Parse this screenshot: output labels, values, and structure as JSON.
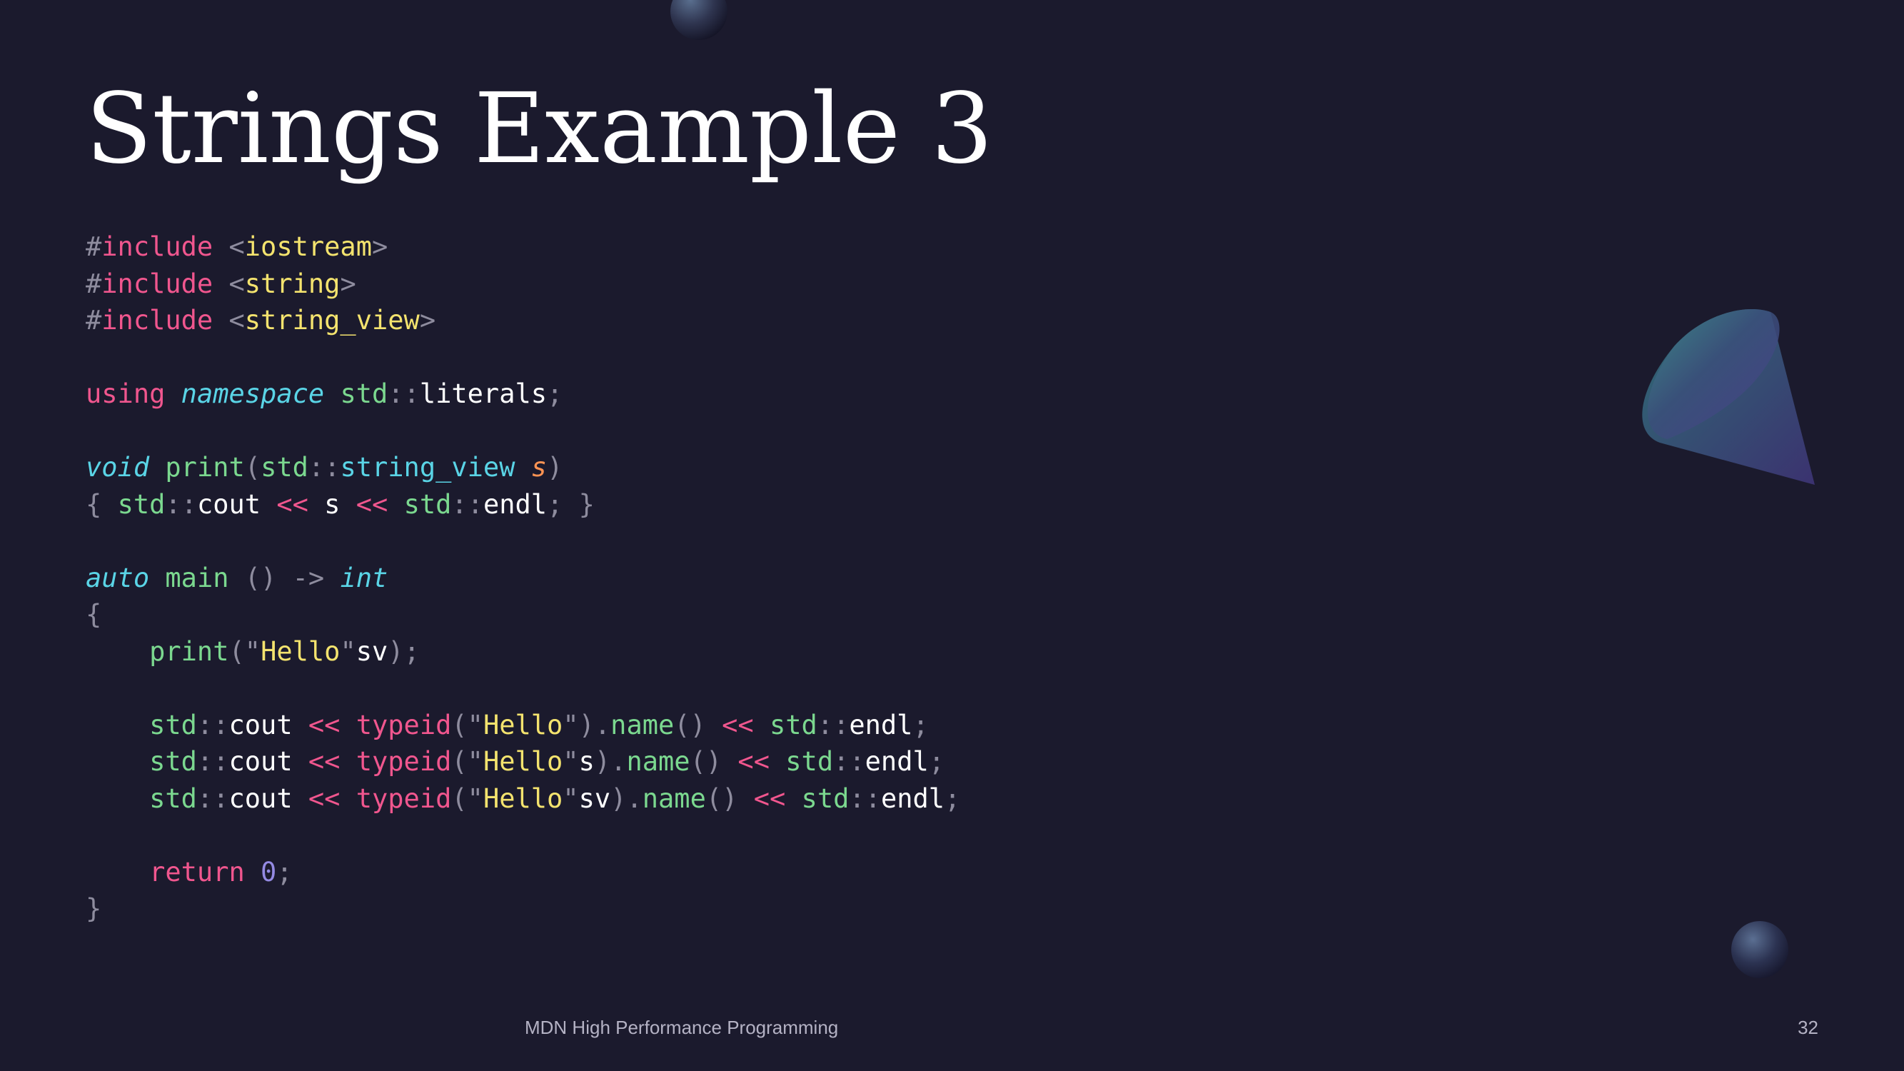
{
  "slide": {
    "title": "Strings Example 3",
    "footer": "MDN High Performance Programming",
    "page_number": "32"
  },
  "code": {
    "language": "cpp",
    "lines": [
      [
        [
          "punct",
          "#"
        ],
        [
          "kw",
          "include"
        ],
        [
          "plain",
          " "
        ],
        [
          "punct",
          "<"
        ],
        [
          "str",
          "iostream"
        ],
        [
          "punct",
          ">"
        ]
      ],
      [
        [
          "punct",
          "#"
        ],
        [
          "kw",
          "include"
        ],
        [
          "plain",
          " "
        ],
        [
          "punct",
          "<"
        ],
        [
          "str",
          "string"
        ],
        [
          "punct",
          ">"
        ]
      ],
      [
        [
          "punct",
          "#"
        ],
        [
          "kw",
          "include"
        ],
        [
          "plain",
          " "
        ],
        [
          "punct",
          "<"
        ],
        [
          "str",
          "string_view"
        ],
        [
          "punct",
          ">"
        ]
      ],
      [],
      [
        [
          "kw",
          "using"
        ],
        [
          "plain",
          " "
        ],
        [
          "type",
          "namespace"
        ],
        [
          "plain",
          " "
        ],
        [
          "ns",
          "std"
        ],
        [
          "punct",
          "::"
        ],
        [
          "plain",
          "literals"
        ],
        [
          "punct",
          ";"
        ]
      ],
      [],
      [
        [
          "type",
          "void"
        ],
        [
          "plain",
          " "
        ],
        [
          "fn",
          "print"
        ],
        [
          "punct",
          "("
        ],
        [
          "ns",
          "std"
        ],
        [
          "punct",
          "::"
        ],
        [
          "flat",
          "string_view"
        ],
        [
          "plain",
          " "
        ],
        [
          "param",
          "s"
        ],
        [
          "punct",
          ")"
        ]
      ],
      [
        [
          "punct",
          "{"
        ],
        [
          "plain",
          " "
        ],
        [
          "ns",
          "std"
        ],
        [
          "punct",
          "::"
        ],
        [
          "plain",
          "cout "
        ],
        [
          "kw",
          "<<"
        ],
        [
          "plain",
          " s "
        ],
        [
          "kw",
          "<<"
        ],
        [
          "plain",
          " "
        ],
        [
          "ns",
          "std"
        ],
        [
          "punct",
          "::"
        ],
        [
          "plain",
          "endl"
        ],
        [
          "punct",
          ";"
        ],
        [
          "plain",
          " "
        ],
        [
          "punct",
          "}"
        ]
      ],
      [],
      [
        [
          "type",
          "auto"
        ],
        [
          "plain",
          " "
        ],
        [
          "fn",
          "main"
        ],
        [
          "plain",
          " "
        ],
        [
          "punct",
          "()"
        ],
        [
          "plain",
          " "
        ],
        [
          "punct",
          "->"
        ],
        [
          "plain",
          " "
        ],
        [
          "type",
          "int"
        ]
      ],
      [
        [
          "punct",
          "{"
        ]
      ],
      [
        [
          "plain",
          "    "
        ],
        [
          "fn",
          "print"
        ],
        [
          "punct",
          "(\""
        ],
        [
          "str",
          "Hello"
        ],
        [
          "punct",
          "\""
        ],
        [
          "plain",
          "sv"
        ],
        [
          "punct",
          ");"
        ]
      ],
      [],
      [
        [
          "plain",
          "    "
        ],
        [
          "ns",
          "std"
        ],
        [
          "punct",
          "::"
        ],
        [
          "plain",
          "cout "
        ],
        [
          "kw",
          "<<"
        ],
        [
          "plain",
          " "
        ],
        [
          "kw",
          "typeid"
        ],
        [
          "punct",
          "(\""
        ],
        [
          "str",
          "Hello"
        ],
        [
          "punct",
          "\")."
        ],
        [
          "fn",
          "name"
        ],
        [
          "punct",
          "()"
        ],
        [
          "plain",
          " "
        ],
        [
          "kw",
          "<<"
        ],
        [
          "plain",
          " "
        ],
        [
          "ns",
          "std"
        ],
        [
          "punct",
          "::"
        ],
        [
          "plain",
          "endl"
        ],
        [
          "punct",
          ";"
        ]
      ],
      [
        [
          "plain",
          "    "
        ],
        [
          "ns",
          "std"
        ],
        [
          "punct",
          "::"
        ],
        [
          "plain",
          "cout "
        ],
        [
          "kw",
          "<<"
        ],
        [
          "plain",
          " "
        ],
        [
          "kw",
          "typeid"
        ],
        [
          "punct",
          "(\""
        ],
        [
          "str",
          "Hello"
        ],
        [
          "punct",
          "\""
        ],
        [
          "plain",
          "s"
        ],
        [
          "punct",
          ")."
        ],
        [
          "fn",
          "name"
        ],
        [
          "punct",
          "()"
        ],
        [
          "plain",
          " "
        ],
        [
          "kw",
          "<<"
        ],
        [
          "plain",
          " "
        ],
        [
          "ns",
          "std"
        ],
        [
          "punct",
          "::"
        ],
        [
          "plain",
          "endl"
        ],
        [
          "punct",
          ";"
        ]
      ],
      [
        [
          "plain",
          "    "
        ],
        [
          "ns",
          "std"
        ],
        [
          "punct",
          "::"
        ],
        [
          "plain",
          "cout "
        ],
        [
          "kw",
          "<<"
        ],
        [
          "plain",
          " "
        ],
        [
          "kw",
          "typeid"
        ],
        [
          "punct",
          "(\""
        ],
        [
          "str",
          "Hello"
        ],
        [
          "punct",
          "\""
        ],
        [
          "plain",
          "sv"
        ],
        [
          "punct",
          ")."
        ],
        [
          "fn",
          "name"
        ],
        [
          "punct",
          "()"
        ],
        [
          "plain",
          " "
        ],
        [
          "kw",
          "<<"
        ],
        [
          "plain",
          " "
        ],
        [
          "ns",
          "std"
        ],
        [
          "punct",
          "::"
        ],
        [
          "plain",
          "endl"
        ],
        [
          "punct",
          ";"
        ]
      ],
      [],
      [
        [
          "plain",
          "    "
        ],
        [
          "kw",
          "return"
        ],
        [
          "plain",
          " "
        ],
        [
          "num",
          "0"
        ],
        [
          "punct",
          ";"
        ]
      ],
      [
        [
          "punct",
          "}"
        ]
      ]
    ]
  },
  "colors": {
    "background": "#1b1a2d",
    "keyword": "#f0568e",
    "string": "#f4e36e",
    "function": "#7bd88f",
    "type": "#5ad4e6",
    "parameter": "#fd9353",
    "number": "#948ae3",
    "punctuation": "#8e8c9e"
  },
  "decorations": [
    "sphere-top",
    "cone-right",
    "sphere-bottom-right"
  ]
}
